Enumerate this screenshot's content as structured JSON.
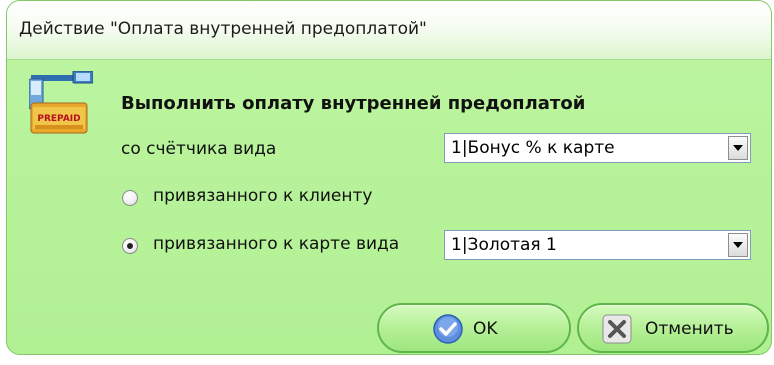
{
  "window": {
    "title": "Действие \"Оплата внутренней предоплатой\""
  },
  "content": {
    "heading": "Выполнить оплату внутренней предоплатой",
    "counter_label": "со счётчика вида",
    "counter_select_value": "1|Бонус % к карте",
    "radio_client_label": "привязанного к клиенту",
    "radio_client_checked": false,
    "radio_card_label": "привязанного к карте вида",
    "radio_card_checked": true,
    "card_select_value": "1|Золотая 1",
    "icon_badge_text": "PREPAID"
  },
  "buttons": {
    "ok_label": "OK",
    "cancel_label": "Отменить"
  },
  "colors": {
    "dialog_bg": "#b8f39b",
    "border": "#82c769",
    "button_border": "#5fb648"
  },
  "icons": [
    "prepaid-terminal-icon",
    "check-icon",
    "close-x-icon",
    "dropdown-arrow-icon"
  ]
}
